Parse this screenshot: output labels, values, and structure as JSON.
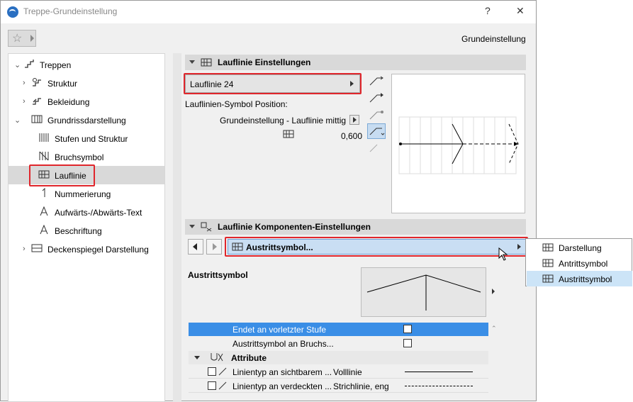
{
  "window": {
    "title": "Treppe-Grundeinstellung",
    "help": "?",
    "close": "✕",
    "section_title": "Grundeinstellung"
  },
  "tree": {
    "items": [
      {
        "label": "Treppen",
        "icon": "stair-icon"
      },
      {
        "label": "Struktur",
        "icon": "structure-icon"
      },
      {
        "label": "Bekleidung",
        "icon": "cladding-icon"
      },
      {
        "label": "Grundrissdarstellung",
        "icon": "floorplan-icon"
      },
      {
        "label": "Stufen und Struktur",
        "icon": "steps-icon"
      },
      {
        "label": "Bruchsymbol",
        "icon": "break-symbol-icon"
      },
      {
        "label": "Lauflinie",
        "icon": "walking-line-icon"
      },
      {
        "label": "Nummerierung",
        "icon": "numbering-icon"
      },
      {
        "label": "Aufwärts-/Abwärts-Text",
        "icon": "updown-text-icon"
      },
      {
        "label": "Beschriftung",
        "icon": "label-icon"
      },
      {
        "label": "Deckenspiegel Darstellung",
        "icon": "ceiling-icon"
      }
    ]
  },
  "lauflinie": {
    "header": "Lauflinie Einstellungen",
    "dropdown": "Lauflinie 24",
    "symbol_position_label": "Lauflinien-Symbol Position:",
    "symbol_position_value": "Grundeinstellung - Lauflinie mittig",
    "offset_value": "0,600"
  },
  "komponenten": {
    "header": "Lauflinie Komponenten-Einstellungen",
    "dropdown": "Austrittsymbol...",
    "popup": [
      "Darstellung",
      "Antrittsymbol",
      "Austrittsymbol"
    ],
    "section_label": "Austrittsymbol"
  },
  "table": {
    "rows": [
      {
        "label": "Endet an vorletzter Stufe",
        "checked": false
      },
      {
        "label": "Austrittsymbol an Bruchs...",
        "checked": false
      }
    ],
    "group": "Attribute",
    "attr_rows": [
      {
        "label": "Linientyp an sichtbarem ...",
        "value": "Volllinie"
      },
      {
        "label": "Linientyp an verdeckten ...",
        "value": "Strichlinie, eng"
      }
    ]
  },
  "colors": {
    "highlight": "#e0262c",
    "selection": "#3a8ee6"
  }
}
